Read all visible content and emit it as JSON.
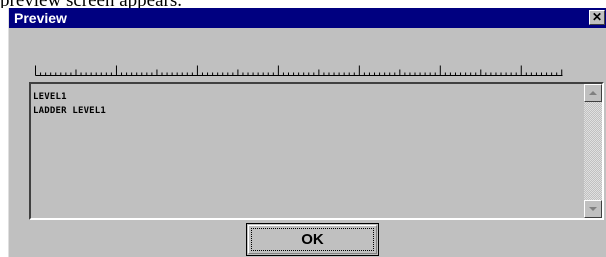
{
  "caption": {
    "text": "preview screen appears."
  },
  "dialog": {
    "title": "Preview",
    "close_glyph": "✕"
  },
  "preview": {
    "lines": [
      "LEVEL1",
      "LADDER LEVEL1"
    ]
  },
  "ok_label": "OK",
  "icons": {
    "close": "close-icon",
    "scroll_up": "scroll-up-arrow-icon",
    "scroll_down": "scroll-down-arrow-icon"
  },
  "colors": {
    "titlebar": "#000080",
    "dialog_bg": "#c0c0c0"
  }
}
